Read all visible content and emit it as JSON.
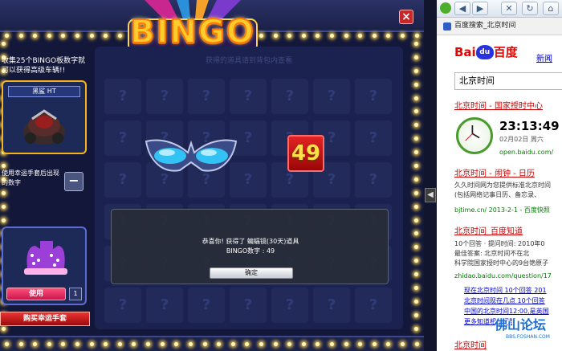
{
  "game": {
    "close_label": "×",
    "logo_text": "BINGO",
    "collect_text": "收集25个BINGO板数字就可以获得高级车辆!!",
    "car_name": "黑鲨 HT",
    "lucky_text": "使用幸运手套后出现的数字",
    "minus_label": "−",
    "use_label": "使用",
    "glove_count": "1",
    "buy_label": "购买幸运手套",
    "grid_hint": "获得的道具请到背包内查看",
    "cell_glyph": "?",
    "drawn_number": "49",
    "dialog": {
      "message": "恭喜你! 获得了 蝙蝠镜(30天)道具",
      "number_line": "BINGO数字 : 49",
      "confirm_label": "确定"
    }
  },
  "divider": {
    "arrow_label": "◀"
  },
  "browser": {
    "toolbar": {
      "back": "◀",
      "forward": "▶",
      "close": "✕",
      "refresh": "↻",
      "home": "⌂"
    },
    "tab_title": "百度搜索_北京时间",
    "logo_prefix": "Bai",
    "logo_du": "du",
    "logo_suffix": "百度",
    "news_link": "新闻",
    "search_value": "北京时间",
    "results": [
      {
        "title": "北京时间 - 国家授时中心"
      },
      {
        "title": "北京时间 - 闹钟 - 日历",
        "desc1": "久久时间网为您提供标准北京时间",
        "desc2": "(包括网络记事日历、备忘录、",
        "url": "bjtime.cn/ 2013-2-1 - 百度快照"
      },
      {
        "title": "北京时间_百度知道",
        "desc1": "10个回答 · 提问时间: 2010年0",
        "desc2": "最佳答案: 北京时间不在北",
        "desc3": "科学院国家授时中心的9台铯原子",
        "url": "zhidao.baidu.com/question/17"
      }
    ],
    "clock": {
      "time": "23:13:49",
      "date": "02月02日 周六",
      "url": "open.baidu.com/"
    },
    "sub_links": [
      "现在北京时间 10个回答 201",
      "北京时间现在几点 10个回答",
      "中国的北京时间12:00,是英国",
      "更多知道相关问题"
    ],
    "last_title": "北京时间",
    "watermark": "佛山论坛",
    "watermark_url": "BBS.FOSHAN.COM"
  },
  "colors": {
    "accent_gold": "#ffcc2e",
    "baidu_red": "#e10602",
    "baidu_blue": "#2932e1",
    "link_red": "#c00"
  }
}
